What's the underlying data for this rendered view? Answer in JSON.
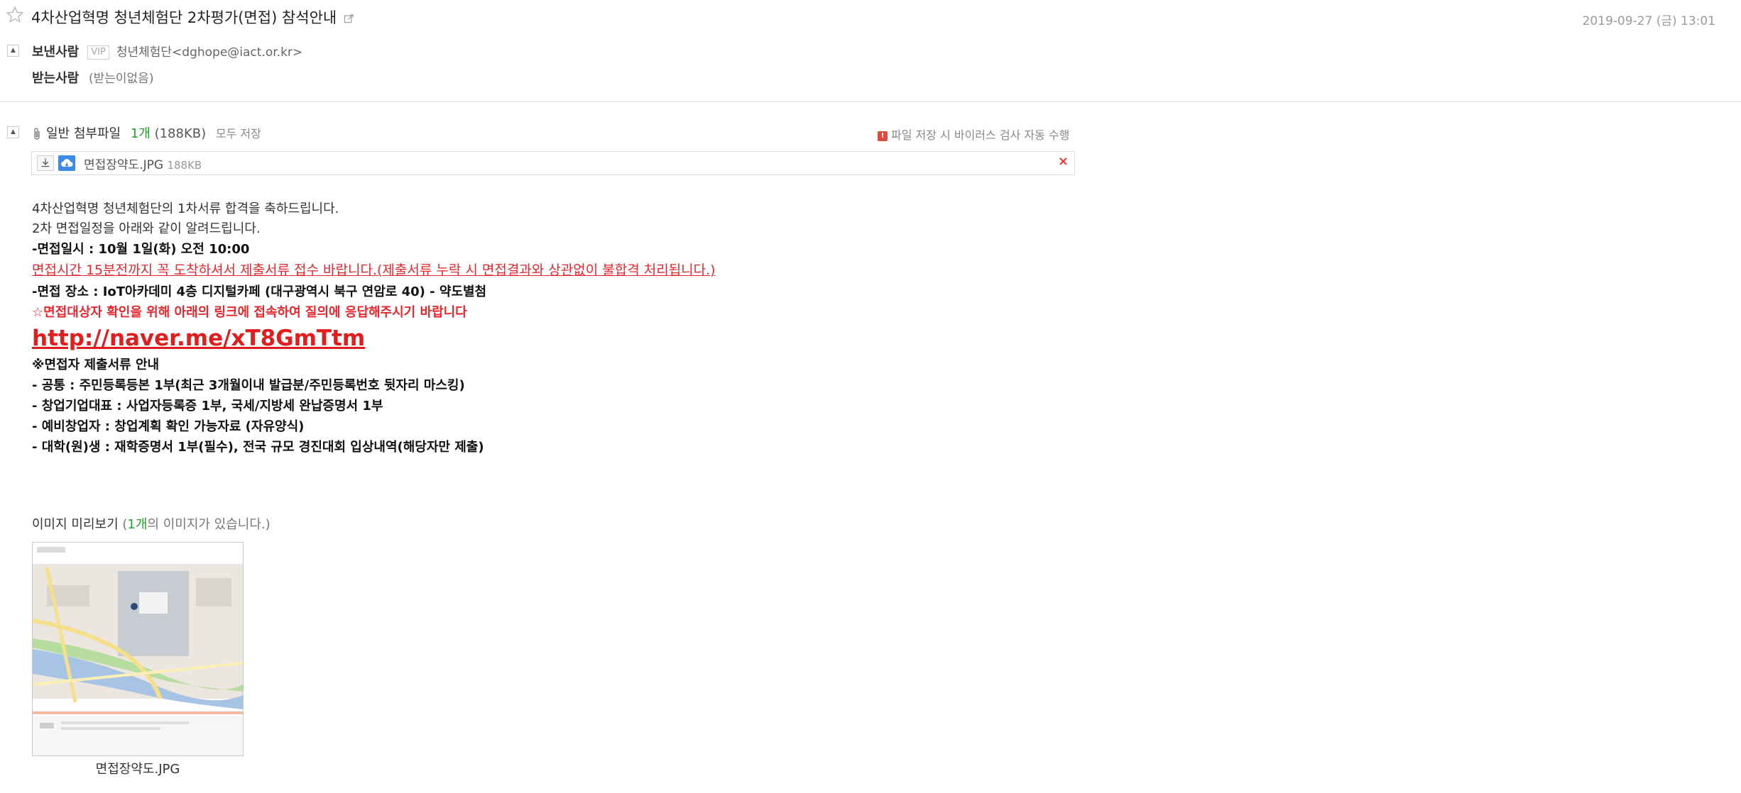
{
  "mail": {
    "subject": "4차산업혁명 청년체험단 2차평가(면접) 참석안내",
    "date": "2019-09-27 (금) 13:01",
    "sender_label": "보낸사람",
    "vip_badge": "VIP",
    "sender": "청년체험단<dghope@iact.or.kr>",
    "receiver_label": "받는사람",
    "receiver": "(받는이없음)"
  },
  "attachments": {
    "title": "일반 첨부파일",
    "count": "1개",
    "size": "(188KB)",
    "save_all": "모두 저장",
    "virus_notice": "파일 저장 시 바이러스 검사 자동 수행",
    "virus_badge": "!",
    "files": [
      {
        "name": "면접장약도.JPG",
        "size": "188KB"
      }
    ],
    "remove_glyph": "×"
  },
  "body": {
    "line1": "4차산업혁명 청년체험단의 1차서류 합격을 축하드립니다.",
    "line2": "2차 면접일정을 아래와 같이 알려드립니다.",
    "line3": "-면접일시 : 10월 1일(화) 오전 10:00",
    "line4": "면접시간 15분전까지 꼭 도착하셔서 제출서류 접수 바랍니다.(제출서류 누락 시 면접결과와 상관없이 불합격 처리됩니다.)",
    "line5": "-면접 장소 : IoT아카데미 4층 디지털카페 (대구광역시 북구 연암로 40)  - 약도별첨",
    "line6": "☆면접대상자 확인을 위해 아래의 링크에 접속하여 질의에 응답해주시기 바랍니다",
    "link": "http://naver.me/xT8GmTtm",
    "line7": " ※면접자 제출서류 안내",
    "line8": "- 공통 : 주민등록등본 1부(최근 3개월이내 발급분/주민등록번호 뒷자리 마스킹)",
    "line9": "- 창업기업대표 : 사업자등록증 1부, 국세/지방세 완납증명서 1부",
    "line10": "- 예비창업자 : 창업계획 확인 가능자료 (자유양식)",
    "line11": "- 대학(원)생 : 재학증명서 1부(필수), 전국 규모 경진대회 입상내역(해당자만 제출)"
  },
  "preview": {
    "label": "이미지 미리보기",
    "paren_open": "(",
    "count": "1개",
    "suffix": "의 이미지가 있습니다.)",
    "caption": "면접장약도.JPG"
  },
  "colors": {
    "accent_green": "#21a327",
    "alert_red": "#e8262b",
    "link_red": "#e11d1d"
  },
  "icons": {
    "star": "star-outline-icon",
    "popout": "external-window-icon",
    "toggle": "collapse-triangle-icon",
    "clip": "paperclip-icon",
    "download": "download-icon",
    "cloud": "cloud-save-icon",
    "remove": "close-x-icon"
  }
}
